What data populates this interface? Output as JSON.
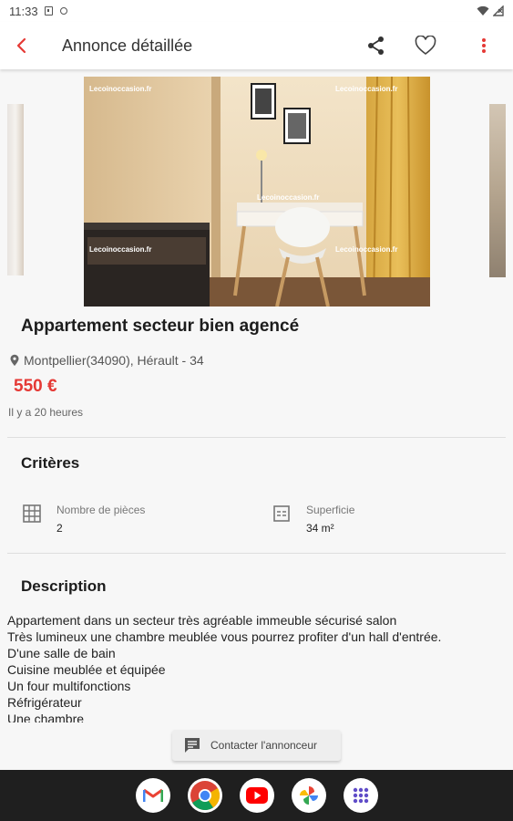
{
  "status_bar": {
    "time": "11:33",
    "left_icons": [
      "notification-square-icon",
      "notification-dot-icon"
    ],
    "right_icons": [
      "wifi-icon",
      "signal-icon"
    ]
  },
  "app_bar": {
    "title": "Annonce détaillée",
    "back_icon": "back-chevron-icon",
    "actions": [
      "share-icon",
      "favorite-heart-icon",
      "more-vert-icon"
    ],
    "accent_color": "#e53935"
  },
  "gallery": {
    "watermark": "Lecoinoccasion.fr"
  },
  "listing": {
    "title": "Appartement secteur bien agencé",
    "location": "Montpellier(34090), Hérault - 34",
    "price": "550 €",
    "posted": "Il y a 20 heures"
  },
  "criteria": {
    "title": "Critères",
    "items": [
      {
        "label": "Nombre de pièces",
        "value": "2",
        "icon": "grid-icon"
      },
      {
        "label": "Superficie",
        "value": "34 m²",
        "icon": "area-icon"
      }
    ]
  },
  "description": {
    "title": "Description",
    "lines": [
      "Appartement dans un secteur très agréable immeuble sécurisé salon",
      "Très lumineux une chambre meublée vous pourrez profiter d'un hall d'entrée.",
      "D'une salle de bain",
      "Cuisine meublée et équipée",
      "Un four multifonctions",
      "Réfrigérateur",
      "Une chambre"
    ]
  },
  "contact_button": {
    "label": "Contacter l'annonceur",
    "icon": "chat-icon"
  },
  "dock": {
    "apps": [
      "gmail-icon",
      "chrome-icon",
      "youtube-icon",
      "photos-icon",
      "app-drawer-icon"
    ]
  }
}
